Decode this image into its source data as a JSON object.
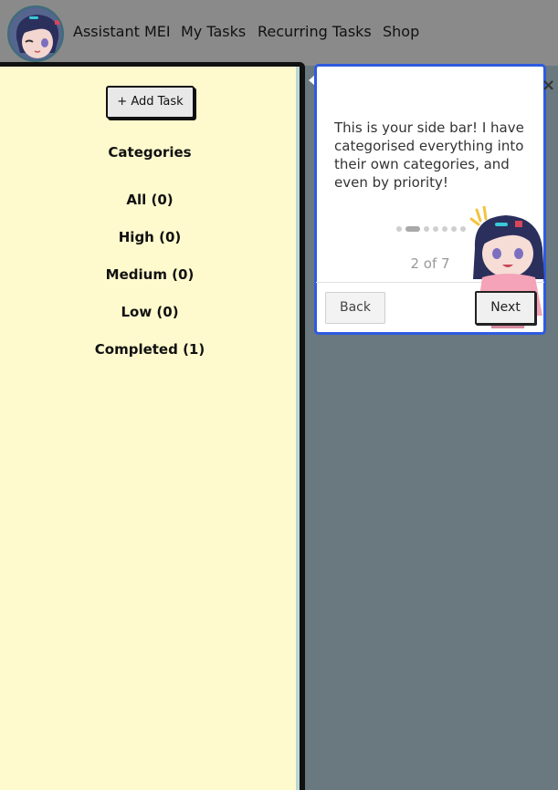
{
  "nav": {
    "brand": "Assistant MEI",
    "my_tasks": "My Tasks",
    "recurring_tasks": "Recurring Tasks",
    "shop": "Shop"
  },
  "sidebar": {
    "add_task": "+ Add Task",
    "heading": "Categories",
    "categories": [
      {
        "label": "All (0)"
      },
      {
        "label": "High (0)"
      },
      {
        "label": "Medium (0)"
      },
      {
        "label": "Low (0)"
      },
      {
        "label": "Completed (1)"
      }
    ]
  },
  "tour": {
    "close_glyph": "×",
    "text": "This is your side bar! I have categorised everything into their own categories, and even by priority!",
    "step": 2,
    "total_steps": 7,
    "progress": "2 of 7",
    "back_label": "Back",
    "next_label": "Next"
  },
  "colors": {
    "nav_bg": "#8a8a8a",
    "sidebar_bg": "#fffacd",
    "main_bg": "#69797f",
    "tour_border": "#2e5be0"
  }
}
